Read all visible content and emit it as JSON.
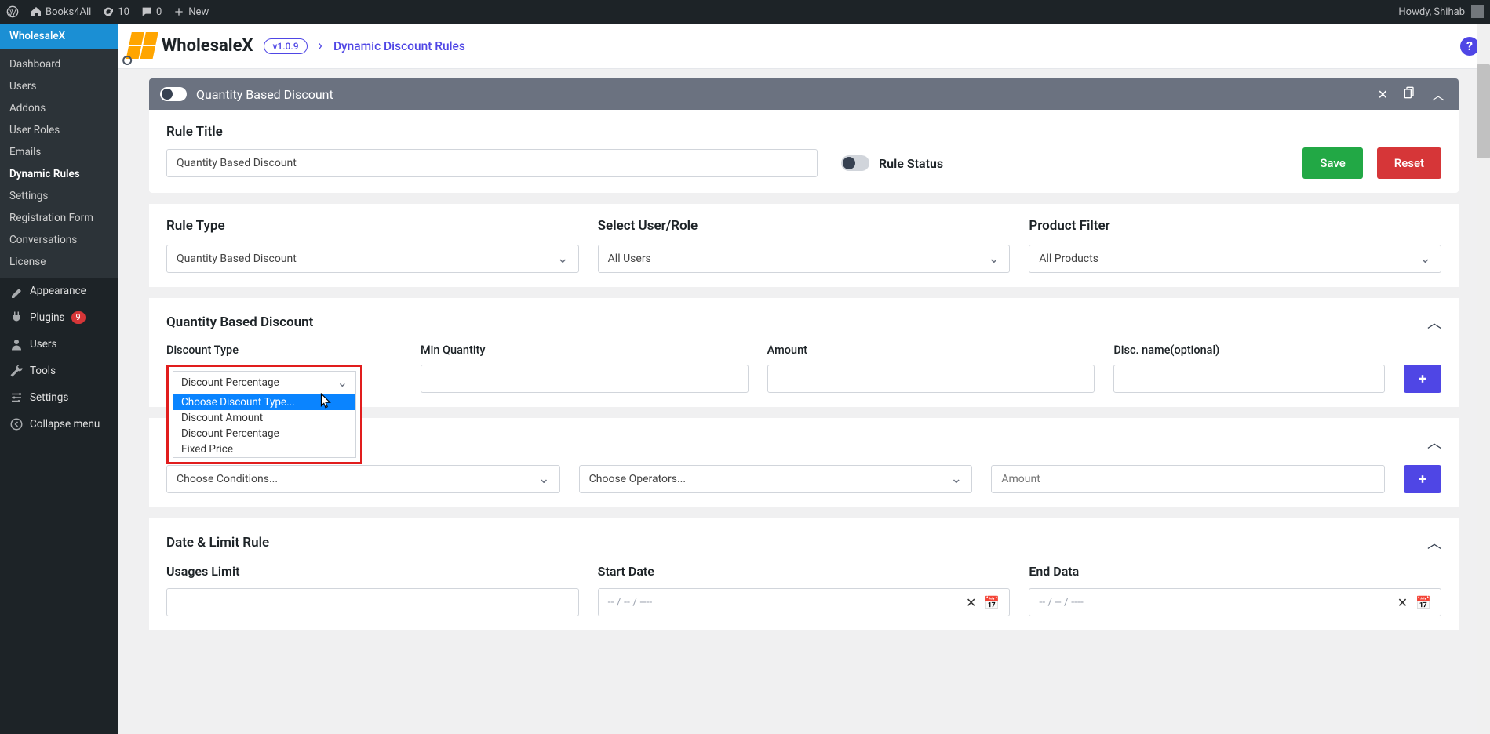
{
  "adminbar": {
    "site": "Books4All",
    "updates": "10",
    "comments": "0",
    "new": "New",
    "howdy": "Howdy, Shihab"
  },
  "sidebar": {
    "active_tab": "WholesaleX",
    "subitems": [
      "Dashboard",
      "Users",
      "Addons",
      "User Roles",
      "Emails",
      "Dynamic Rules",
      "Settings",
      "Registration Form",
      "Conversations",
      "License"
    ],
    "active_sub": "Dynamic Rules",
    "items": [
      {
        "icon": "brush",
        "label": "Appearance"
      },
      {
        "icon": "plug",
        "label": "Plugins",
        "badge": "9"
      },
      {
        "icon": "user",
        "label": "Users"
      },
      {
        "icon": "wrench",
        "label": "Tools"
      },
      {
        "icon": "sliders",
        "label": "Settings"
      },
      {
        "icon": "collapse",
        "label": "Collapse menu"
      }
    ]
  },
  "header": {
    "brand": "WholesaleX",
    "version": "v1.0.9",
    "crumb": "Dynamic Discount Rules",
    "help": "?"
  },
  "rulebar": {
    "title": "Quantity Based Discount"
  },
  "ruleTitleSection": {
    "label": "Rule Title",
    "value": "Quantity Based Discount",
    "statusLabel": "Rule Status",
    "save": "Save",
    "reset": "Reset"
  },
  "ruleTypeSection": {
    "ruleType": {
      "label": "Rule Type",
      "value": "Quantity Based Discount"
    },
    "userRole": {
      "label": "Select User/Role",
      "value": "All Users"
    },
    "productFilter": {
      "label": "Product Filter",
      "value": "All Products"
    }
  },
  "qbd": {
    "section": "Quantity Based Discount",
    "discountType": {
      "label": "Discount Type",
      "selected": "Discount Percentage",
      "options": [
        "Choose Discount Type...",
        "Discount Amount",
        "Discount Percentage",
        "Fixed Price"
      ]
    },
    "minQty": {
      "label": "Min Quantity"
    },
    "amount": {
      "label": "Amount"
    },
    "discName": {
      "label": "Disc. name(optional)"
    }
  },
  "conditions": {
    "chooseConditions": "Choose Conditions...",
    "chooseOperators": "Choose Operators...",
    "amountPlaceholder": "Amount"
  },
  "dateLimit": {
    "section": "Date & Limit Rule",
    "usagesLimit": "Usages Limit",
    "startDate": "Start Date",
    "endData": "End Data",
    "datePlaceholder": "-- / -- / ----"
  }
}
